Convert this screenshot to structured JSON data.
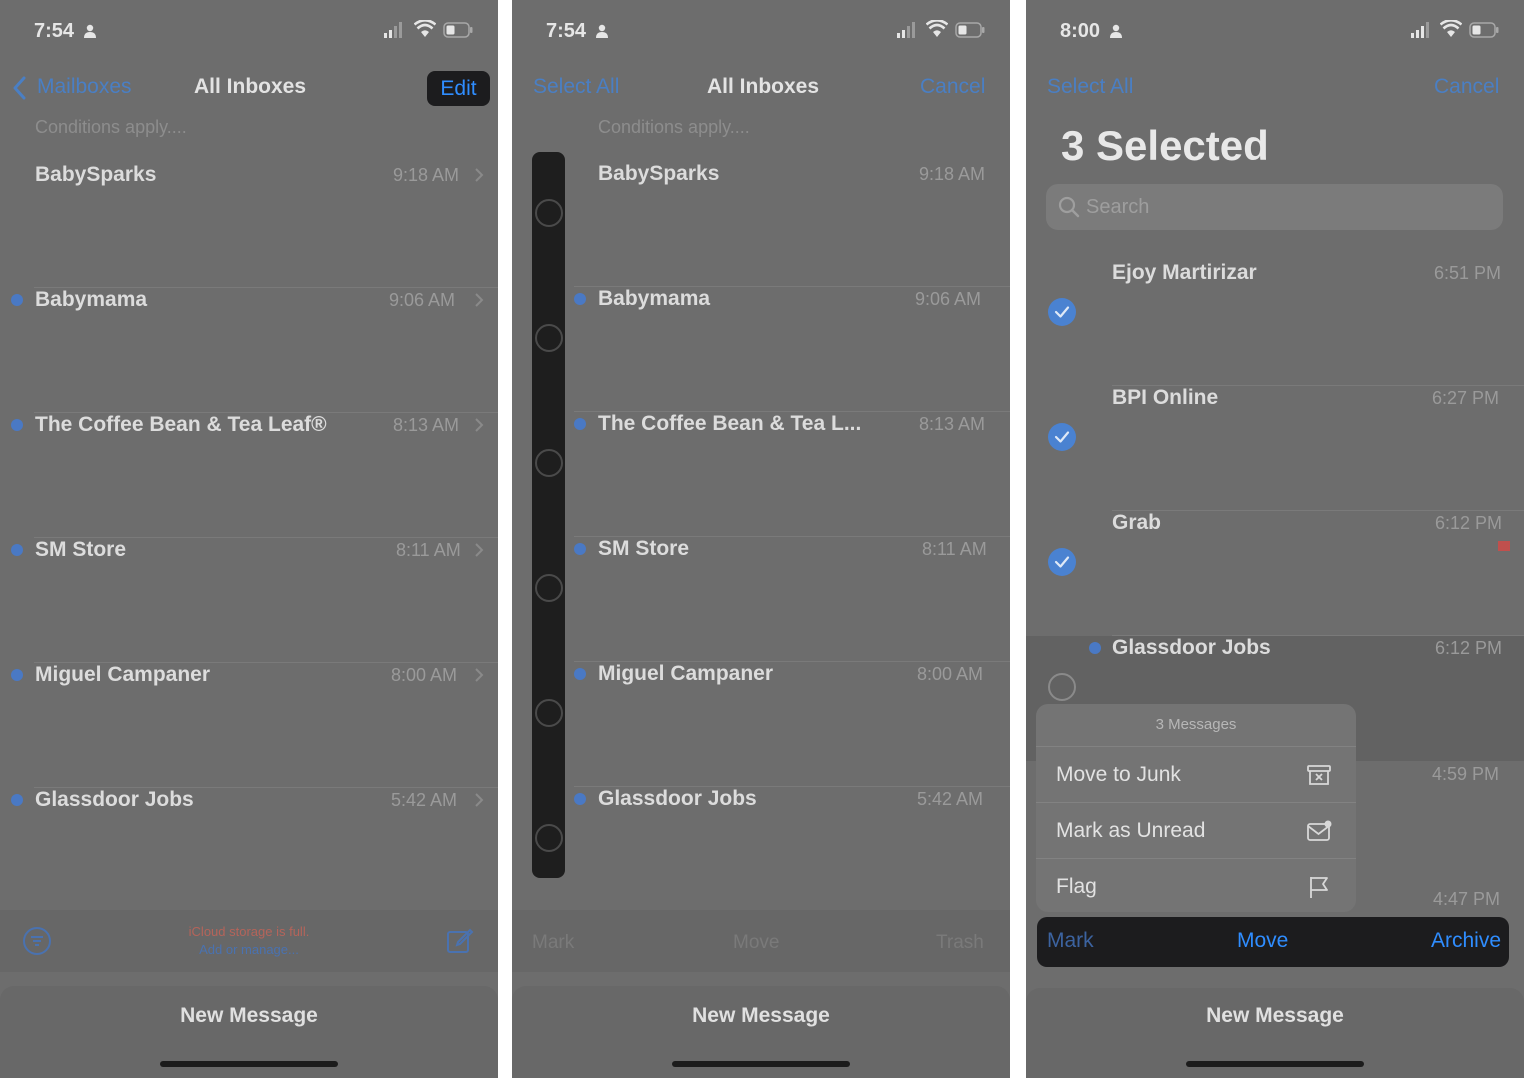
{
  "colors": {
    "accent": "#2f8dff",
    "unread_dot": "#4a79c4",
    "screen_overlay": "#6d6d6d",
    "warning": "#b5645a"
  },
  "panel1": {
    "status": {
      "time": "7:54"
    },
    "nav": {
      "back_label": "Mailboxes",
      "title": "All Inboxes",
      "edit_label": "Edit"
    },
    "conditions": "Conditions apply....",
    "rows": [
      {
        "sender": "BabySparks",
        "time": "9:18 AM",
        "unread": false
      },
      {
        "sender": "Babymama",
        "time": "9:06 AM",
        "unread": true
      },
      {
        "sender": "The Coffee Bean & Tea Leaf®",
        "time": "8:13 AM",
        "unread": true
      },
      {
        "sender": "SM Store",
        "time": "8:11 AM",
        "unread": true
      },
      {
        "sender": "Miguel Campaner",
        "time": "8:00 AM",
        "unread": true
      },
      {
        "sender": "Glassdoor Jobs",
        "time": "5:42 AM",
        "unread": true
      }
    ],
    "toolbar": {
      "warning": "iCloud storage is full.",
      "link": "Add or manage..."
    },
    "new_message": "New Message"
  },
  "panel2": {
    "status": {
      "time": "7:54"
    },
    "nav": {
      "select_all": "Select All",
      "title": "All Inboxes",
      "cancel": "Cancel"
    },
    "conditions": "Conditions apply....",
    "rows": [
      {
        "sender": "BabySparks",
        "time": "9:18 AM",
        "unread": false
      },
      {
        "sender": "Babymama",
        "time": "9:06 AM",
        "unread": true
      },
      {
        "sender": "The Coffee Bean & Tea L...",
        "time": "8:13 AM",
        "unread": true
      },
      {
        "sender": "SM Store",
        "time": "8:11 AM",
        "unread": true
      },
      {
        "sender": "Miguel Campaner",
        "time": "8:00 AM",
        "unread": true
      },
      {
        "sender": "Glassdoor Jobs",
        "time": "5:42 AM",
        "unread": true
      }
    ],
    "toolbar": {
      "mark": "Mark",
      "move": "Move",
      "trash": "Trash"
    },
    "new_message": "New Message"
  },
  "panel3": {
    "status": {
      "time": "8:00"
    },
    "nav": {
      "select_all": "Select All",
      "cancel": "Cancel"
    },
    "title": "3 Selected",
    "search_placeholder": "Search",
    "rows": [
      {
        "sender": "Ejoy Martirizar",
        "time": "6:51 PM",
        "selected": true
      },
      {
        "sender": "BPI Online",
        "time": "6:27 PM",
        "selected": true
      },
      {
        "sender": "Grab",
        "time": "6:12 PM",
        "selected": true
      },
      {
        "sender": "Glassdoor Jobs",
        "time": "6:12 PM",
        "selected": false
      }
    ],
    "extra_times": [
      "4:59 PM",
      "4:47 PM"
    ],
    "popover": {
      "title": "3 Messages",
      "items": [
        {
          "label": "Move to Junk",
          "icon": "junk-icon"
        },
        {
          "label": "Mark as Unread",
          "icon": "unread-envelope-icon"
        },
        {
          "label": "Flag",
          "icon": "flag-icon"
        }
      ]
    },
    "actions": {
      "mark": "Mark",
      "move": "Move",
      "archive": "Archive"
    },
    "new_message": "New Message"
  }
}
